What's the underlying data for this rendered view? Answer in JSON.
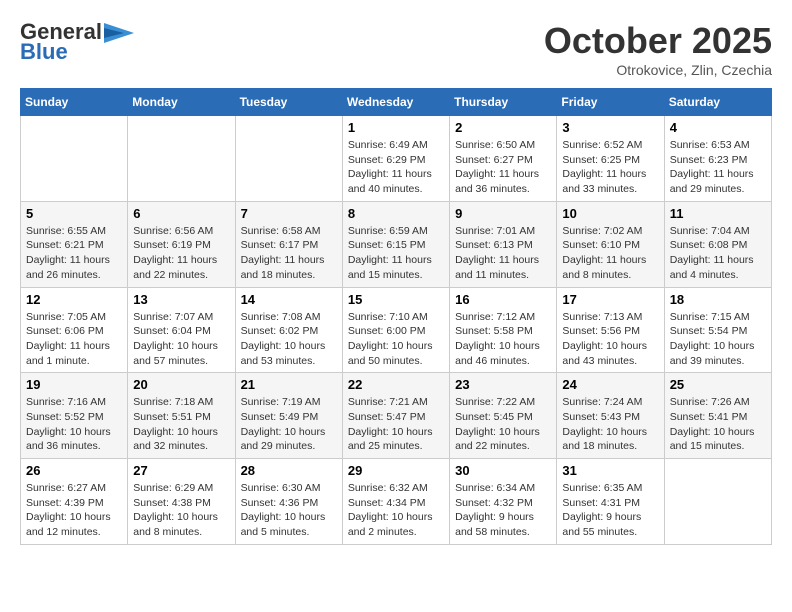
{
  "logo": {
    "line1": "General",
    "line2": "Blue"
  },
  "header": {
    "month": "October 2025",
    "location": "Otrokovice, Zlin, Czechia"
  },
  "weekdays": [
    "Sunday",
    "Monday",
    "Tuesday",
    "Wednesday",
    "Thursday",
    "Friday",
    "Saturday"
  ],
  "weeks": [
    [
      {
        "day": "",
        "info": ""
      },
      {
        "day": "",
        "info": ""
      },
      {
        "day": "",
        "info": ""
      },
      {
        "day": "1",
        "info": "Sunrise: 6:49 AM\nSunset: 6:29 PM\nDaylight: 11 hours\nand 40 minutes."
      },
      {
        "day": "2",
        "info": "Sunrise: 6:50 AM\nSunset: 6:27 PM\nDaylight: 11 hours\nand 36 minutes."
      },
      {
        "day": "3",
        "info": "Sunrise: 6:52 AM\nSunset: 6:25 PM\nDaylight: 11 hours\nand 33 minutes."
      },
      {
        "day": "4",
        "info": "Sunrise: 6:53 AM\nSunset: 6:23 PM\nDaylight: 11 hours\nand 29 minutes."
      }
    ],
    [
      {
        "day": "5",
        "info": "Sunrise: 6:55 AM\nSunset: 6:21 PM\nDaylight: 11 hours\nand 26 minutes."
      },
      {
        "day": "6",
        "info": "Sunrise: 6:56 AM\nSunset: 6:19 PM\nDaylight: 11 hours\nand 22 minutes."
      },
      {
        "day": "7",
        "info": "Sunrise: 6:58 AM\nSunset: 6:17 PM\nDaylight: 11 hours\nand 18 minutes."
      },
      {
        "day": "8",
        "info": "Sunrise: 6:59 AM\nSunset: 6:15 PM\nDaylight: 11 hours\nand 15 minutes."
      },
      {
        "day": "9",
        "info": "Sunrise: 7:01 AM\nSunset: 6:13 PM\nDaylight: 11 hours\nand 11 minutes."
      },
      {
        "day": "10",
        "info": "Sunrise: 7:02 AM\nSunset: 6:10 PM\nDaylight: 11 hours\nand 8 minutes."
      },
      {
        "day": "11",
        "info": "Sunrise: 7:04 AM\nSunset: 6:08 PM\nDaylight: 11 hours\nand 4 minutes."
      }
    ],
    [
      {
        "day": "12",
        "info": "Sunrise: 7:05 AM\nSunset: 6:06 PM\nDaylight: 11 hours\nand 1 minute."
      },
      {
        "day": "13",
        "info": "Sunrise: 7:07 AM\nSunset: 6:04 PM\nDaylight: 10 hours\nand 57 minutes."
      },
      {
        "day": "14",
        "info": "Sunrise: 7:08 AM\nSunset: 6:02 PM\nDaylight: 10 hours\nand 53 minutes."
      },
      {
        "day": "15",
        "info": "Sunrise: 7:10 AM\nSunset: 6:00 PM\nDaylight: 10 hours\nand 50 minutes."
      },
      {
        "day": "16",
        "info": "Sunrise: 7:12 AM\nSunset: 5:58 PM\nDaylight: 10 hours\nand 46 minutes."
      },
      {
        "day": "17",
        "info": "Sunrise: 7:13 AM\nSunset: 5:56 PM\nDaylight: 10 hours\nand 43 minutes."
      },
      {
        "day": "18",
        "info": "Sunrise: 7:15 AM\nSunset: 5:54 PM\nDaylight: 10 hours\nand 39 minutes."
      }
    ],
    [
      {
        "day": "19",
        "info": "Sunrise: 7:16 AM\nSunset: 5:52 PM\nDaylight: 10 hours\nand 36 minutes."
      },
      {
        "day": "20",
        "info": "Sunrise: 7:18 AM\nSunset: 5:51 PM\nDaylight: 10 hours\nand 32 minutes."
      },
      {
        "day": "21",
        "info": "Sunrise: 7:19 AM\nSunset: 5:49 PM\nDaylight: 10 hours\nand 29 minutes."
      },
      {
        "day": "22",
        "info": "Sunrise: 7:21 AM\nSunset: 5:47 PM\nDaylight: 10 hours\nand 25 minutes."
      },
      {
        "day": "23",
        "info": "Sunrise: 7:22 AM\nSunset: 5:45 PM\nDaylight: 10 hours\nand 22 minutes."
      },
      {
        "day": "24",
        "info": "Sunrise: 7:24 AM\nSunset: 5:43 PM\nDaylight: 10 hours\nand 18 minutes."
      },
      {
        "day": "25",
        "info": "Sunrise: 7:26 AM\nSunset: 5:41 PM\nDaylight: 10 hours\nand 15 minutes."
      }
    ],
    [
      {
        "day": "26",
        "info": "Sunrise: 6:27 AM\nSunset: 4:39 PM\nDaylight: 10 hours\nand 12 minutes."
      },
      {
        "day": "27",
        "info": "Sunrise: 6:29 AM\nSunset: 4:38 PM\nDaylight: 10 hours\nand 8 minutes."
      },
      {
        "day": "28",
        "info": "Sunrise: 6:30 AM\nSunset: 4:36 PM\nDaylight: 10 hours\nand 5 minutes."
      },
      {
        "day": "29",
        "info": "Sunrise: 6:32 AM\nSunset: 4:34 PM\nDaylight: 10 hours\nand 2 minutes."
      },
      {
        "day": "30",
        "info": "Sunrise: 6:34 AM\nSunset: 4:32 PM\nDaylight: 9 hours\nand 58 minutes."
      },
      {
        "day": "31",
        "info": "Sunrise: 6:35 AM\nSunset: 4:31 PM\nDaylight: 9 hours\nand 55 minutes."
      },
      {
        "day": "",
        "info": ""
      }
    ]
  ]
}
